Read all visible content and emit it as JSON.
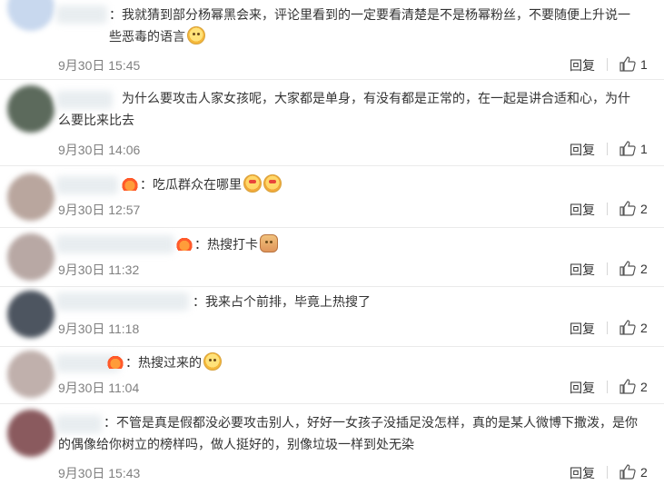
{
  "comments": [
    {
      "text": "：我就猜到部分杨幂黑会来，评论里看到的一定要看清楚是不是杨幂粉丝，不要随便上升说一些恶毒的语言",
      "emojis": [
        "smile"
      ],
      "time": "9月30日 15:45",
      "reply": "回复",
      "likes": "1"
    },
    {
      "text": "为什么要攻击人家女孩呢，大家都是单身，有没有都是正常的，在一起是讲合适和心，为什么要比来比去",
      "emojis": [],
      "time": "9月30日 14:06",
      "reply": "回复",
      "likes": "1"
    },
    {
      "text": "：吃瓜群众在哪里",
      "emojis": [
        "love",
        "love"
      ],
      "time": "9月30日 12:57",
      "reply": "回复",
      "likes": "2"
    },
    {
      "text": "：热搜打卡",
      "emojis": [
        "cat"
      ],
      "time": "9月30日 11:32",
      "reply": "回复",
      "likes": "2"
    },
    {
      "text": "：我来占个前排，毕竟上热搜了",
      "emojis": [],
      "time": "9月30日 11:18",
      "reply": "回复",
      "likes": "2"
    },
    {
      "text": "：热搜过来的",
      "emojis": [
        "dog"
      ],
      "time": "9月30日 11:04",
      "reply": "回复",
      "likes": "2"
    },
    {
      "text": "：不管是真是假都没必要攻击别人，好好一女孩子没插足没怎样，真的是某人微博下撒泼，是你的偶像给你树立的榜样吗，做人挺好的，别像垃圾一样到处无染",
      "emojis": [],
      "time": "9月30日 15:43",
      "reply": "回复",
      "likes": "2"
    }
  ],
  "colors": {
    "text": "#333333",
    "meta": "#808080",
    "divider": "#eaeaea"
  },
  "icons": {
    "like": "thumbs-up-icon",
    "badge": "vip-badge-icon"
  }
}
